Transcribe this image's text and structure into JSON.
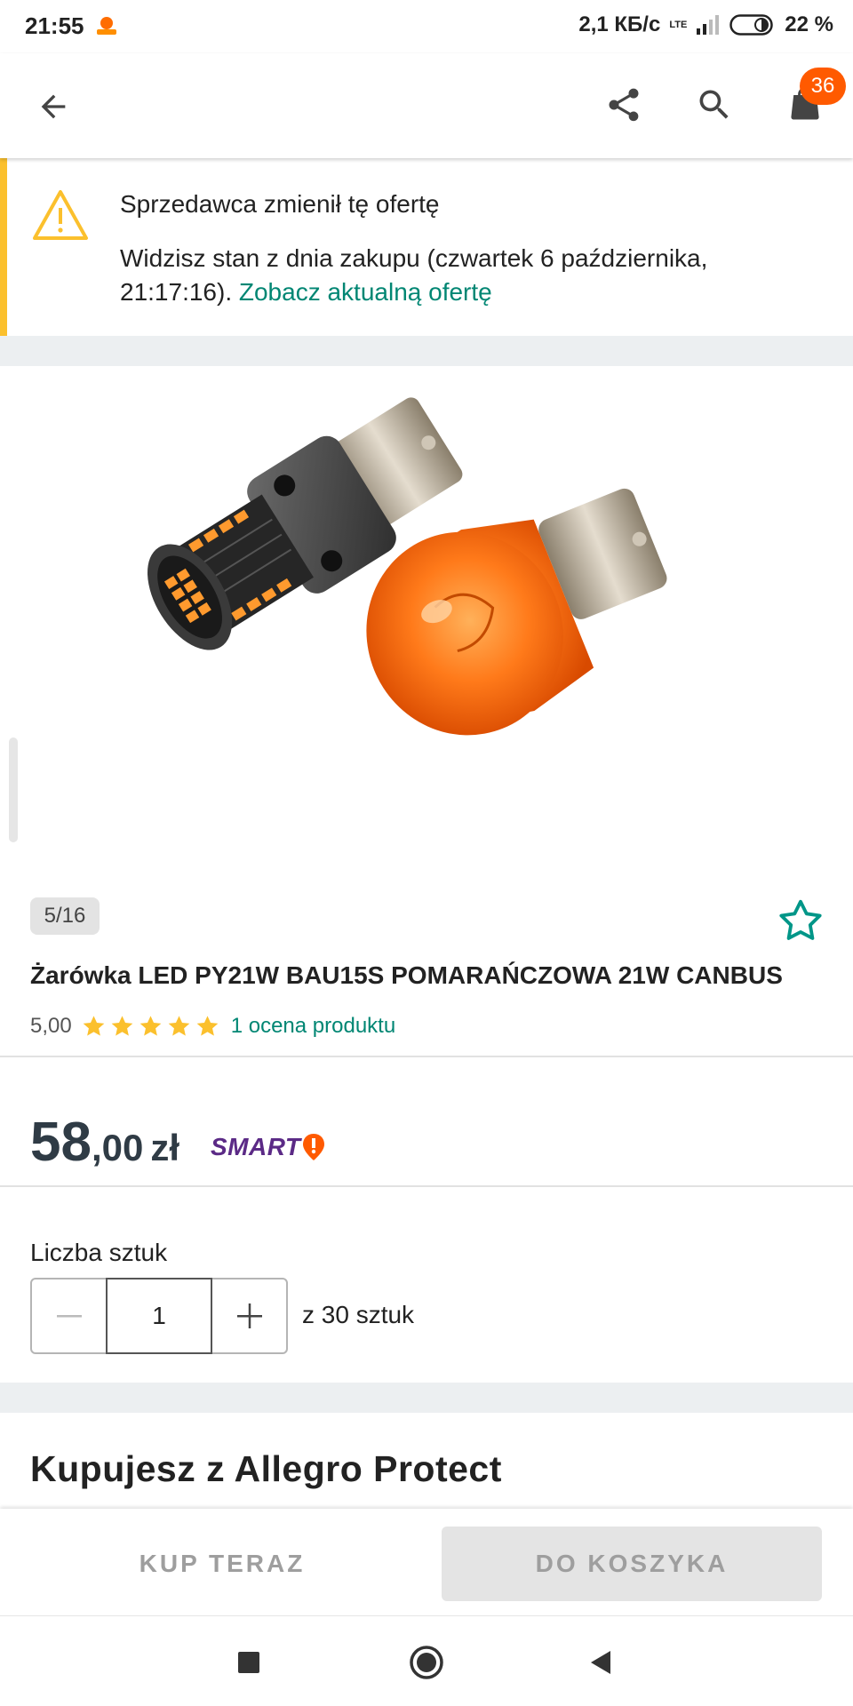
{
  "status_bar": {
    "time": "21:55",
    "network_speed": "2,1 КБ/с",
    "network_type": "LTE",
    "battery": "22 %"
  },
  "app_bar": {
    "cart_count": "36",
    "icons": [
      "back-arrow-icon",
      "share-icon",
      "search-icon",
      "cart-icon"
    ]
  },
  "warning": {
    "title": "Sprzedawca zmienił tę ofertę",
    "body": "Widzisz stan z dnia zakupu (czwartek 6 października, 21:17:16). ",
    "link": "Zobacz aktualną ofertę"
  },
  "product": {
    "gallery_counter": "5/16",
    "title": "Żarówka LED PY21W BAU15S POMARAŃCZOWA 21W CANBUS",
    "rating_value": "5,00",
    "stars": 5,
    "rating_link": "1 ocena produktu",
    "price_int": "58",
    "price_dec": ",00",
    "currency": "zł",
    "smart_label": "SMART"
  },
  "quantity": {
    "label": "Liczba sztuk",
    "value": "1",
    "of_text": "z 30 sztuk"
  },
  "protect": {
    "title": "Kupujesz z Allegro Protect"
  },
  "actions": {
    "buy_now": "KUP TERAZ",
    "add_to_cart": "DO KOSZYKA"
  },
  "colors": {
    "accent_orange": "#ff5a00",
    "link_teal": "#008673",
    "warning_yellow": "#fbc02d",
    "star_yellow": "#fbc02d",
    "smart_purple": "#5b2a86"
  }
}
